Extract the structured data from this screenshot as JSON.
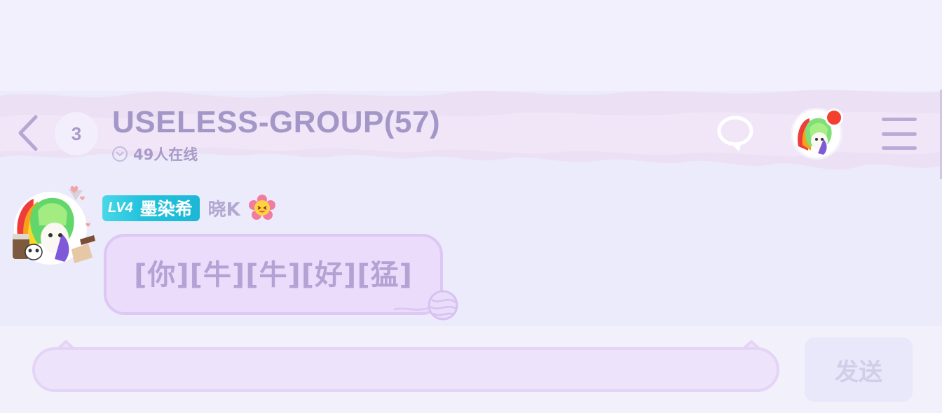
{
  "header": {
    "unread_count": "3",
    "group_title": "USELESS-GROUP(57)",
    "online_text": "49人在线"
  },
  "message": {
    "level": "LV4",
    "member_title": "墨染希",
    "sender_name": "晓K",
    "text": "[你][牛][牛][好][猛]"
  },
  "composer": {
    "input_value": "",
    "send_label": "发送"
  },
  "icons": {
    "back": "chevron-left-icon",
    "online": "chevron-down-circle-icon",
    "chat": "speech-bubble-icon",
    "menu": "hamburger-menu-icon",
    "flower": "flower-emoji-icon",
    "yarn": "yarn-ball-icon"
  },
  "colors": {
    "accent": "#a397c8",
    "level_tag": "#22c3dc",
    "bubble": "#ebdcfb",
    "notification_dot": "#f4402f"
  }
}
